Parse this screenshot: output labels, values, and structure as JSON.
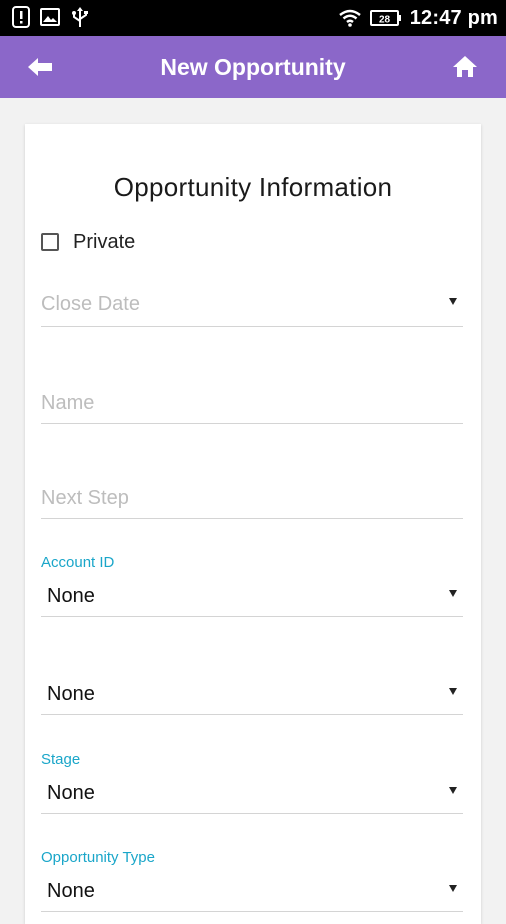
{
  "status_bar": {
    "time": "12:47 pm",
    "battery": "28",
    "icons": [
      "alert-icon",
      "image-icon",
      "usb-icon",
      "wifi-icon",
      "battery-icon"
    ]
  },
  "app_bar": {
    "title": "New Opportunity",
    "background": "#8b67c9",
    "back_icon": "arrow-left-icon",
    "home_icon": "home-icon"
  },
  "form": {
    "section_title": "Opportunity Information",
    "private_label": "Private",
    "close_date_placeholder": "Close Date",
    "name_placeholder": "Name",
    "next_step_placeholder": "Next Step",
    "account_id_label": "Account ID",
    "account_id_value": "None",
    "unlabeled_select_value": "None",
    "stage_label": "Stage",
    "stage_value": "None",
    "opportunity_type_label": "Opportunity Type",
    "opportunity_type_value": "None",
    "label_color": "#1aa6c9"
  }
}
